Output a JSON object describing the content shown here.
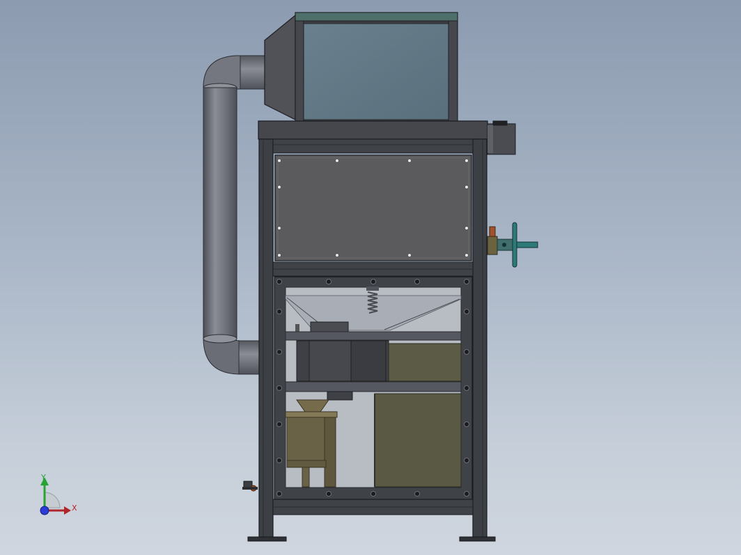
{
  "view": {
    "background_top": "#8c9bb0",
    "background_bottom": "#d0d6df"
  },
  "colors": {
    "frame": "#3c3f44",
    "frame_edge": "#1a1c20",
    "panel": "#5b5b5e",
    "hopper_glass": "#627886",
    "duct": "#6d7079",
    "motor_olive": "#5a5a44",
    "feeder": "#6a6247",
    "handwheel": "#2e7a78",
    "valve_copper": "#a0522d"
  },
  "triad": {
    "x_label": "X",
    "y_label": "Y",
    "x_color": "#b0252a",
    "y_color": "#27a234",
    "z_color": "#2b3bd6"
  }
}
